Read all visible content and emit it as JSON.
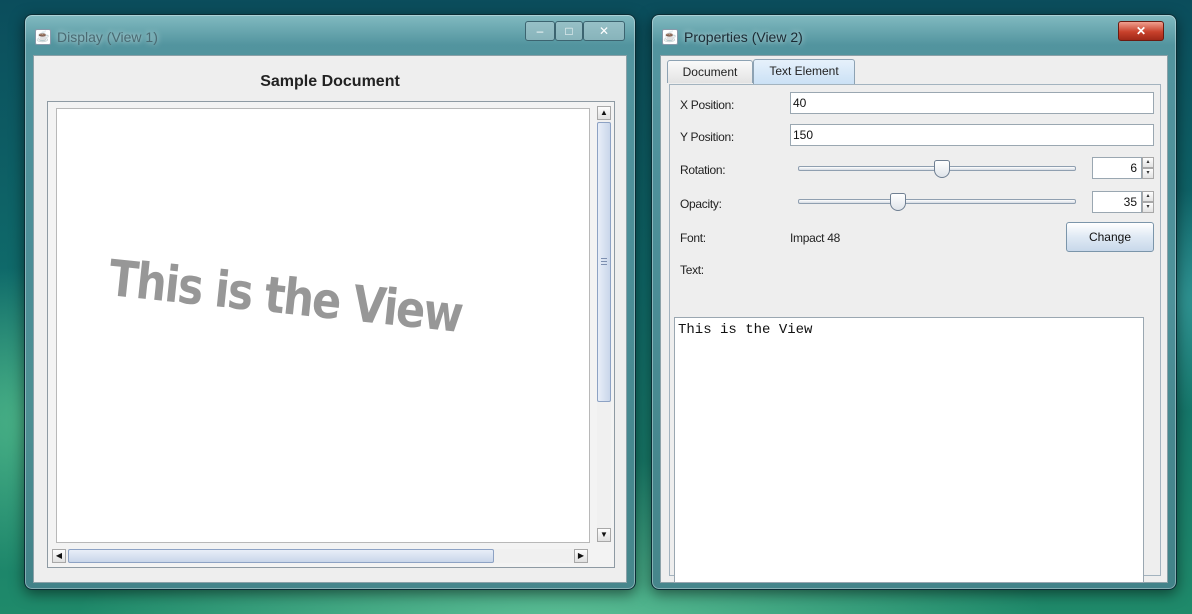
{
  "display_window": {
    "title": "Display (View 1)",
    "controls": {
      "minimize": "–",
      "maximize": "□",
      "close": "✕"
    },
    "document_title": "Sample Document",
    "canvas_text": "This is the View",
    "scroll": {
      "up": "▲",
      "down": "▼",
      "left": "◀",
      "right": "▶"
    }
  },
  "properties_window": {
    "title": "Properties (View 2)",
    "controls": {
      "close": "✕"
    },
    "tabs": [
      "Document",
      "Text Element"
    ],
    "active_tab": "Text Element",
    "x_position": {
      "label": "X Position:",
      "value": "40"
    },
    "y_position": {
      "label": "Y Position:",
      "value": "150"
    },
    "rotation": {
      "label": "Rotation:",
      "value": "6",
      "slider_fraction": 0.52
    },
    "opacity": {
      "label": "Opacity:",
      "value": "35",
      "slider_fraction": 0.35
    },
    "font": {
      "label": "Font:",
      "value": "Impact 48",
      "button": "Change"
    },
    "text": {
      "label": "Text:",
      "value": "This is the View"
    },
    "spin": {
      "up": "▴",
      "down": "▾"
    }
  },
  "colors": {
    "close_button": "#c8412b",
    "active_tab": "#cbe1f5",
    "canvas_text": "#8f8f8f"
  }
}
